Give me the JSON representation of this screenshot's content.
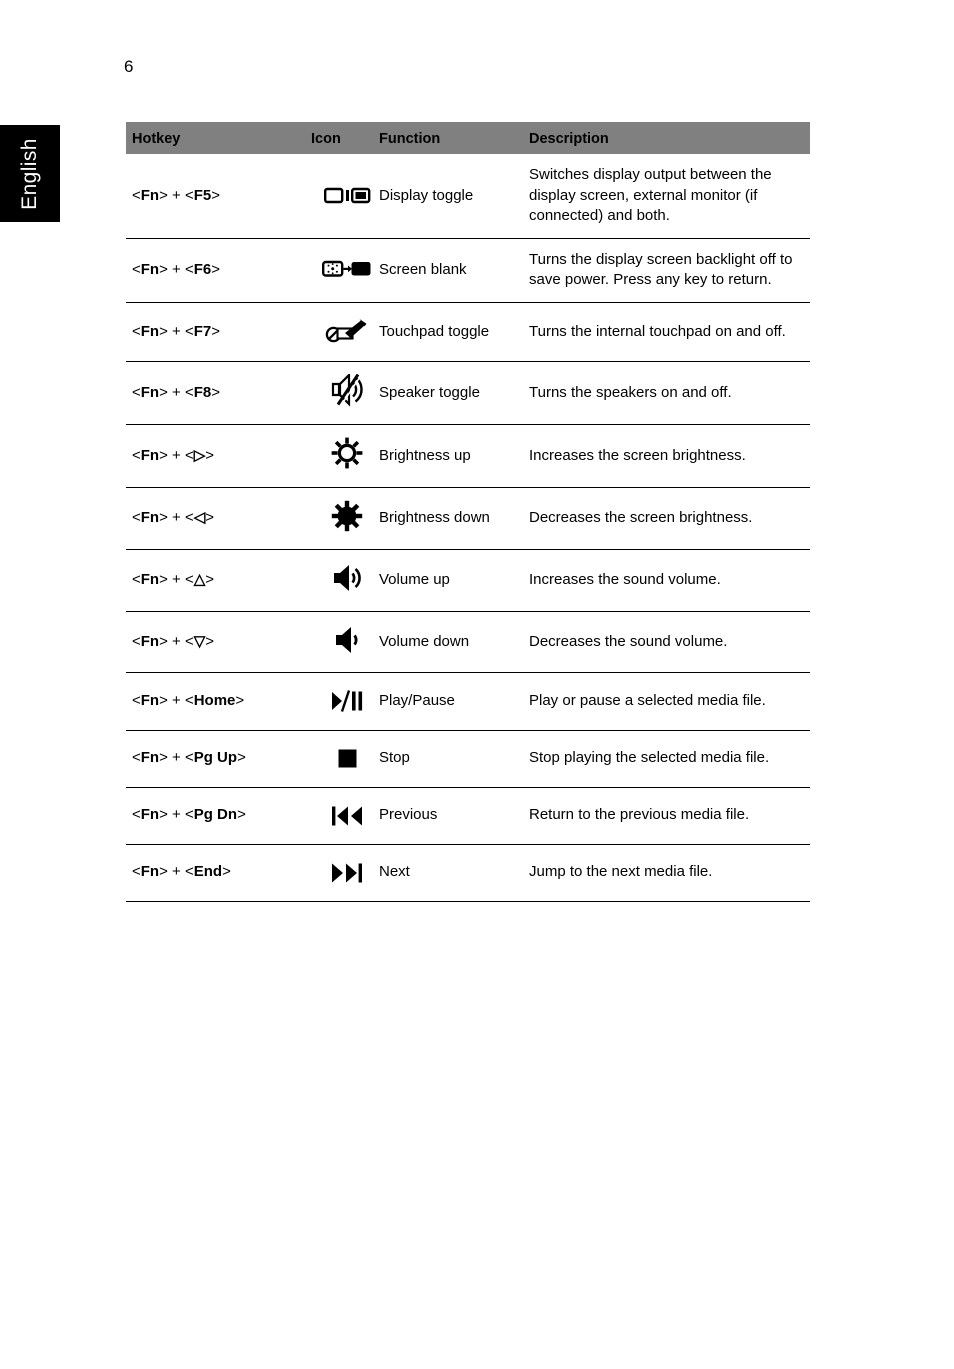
{
  "page": {
    "number": "6",
    "language_tab": "English"
  },
  "table": {
    "headers": {
      "hotkey": "Hotkey",
      "icon": "Icon",
      "function": "Function",
      "description": "Description"
    },
    "rows": [
      {
        "hotkey_prefix": "<",
        "hotkey": "<Fn> + <F5>",
        "hotkey_mod": "Fn",
        "hotkey_key": "F5",
        "icon_name": "display-toggle-icon",
        "function": "Display toggle",
        "description": "Switches display output between the display screen, external monitor (if connected) and both."
      },
      {
        "hotkey": "<Fn> + <F6>",
        "hotkey_mod": "Fn",
        "hotkey_key": "F6",
        "icon_name": "screen-blank-icon",
        "function": "Screen blank",
        "description": "Turns the display screen backlight off to save power. Press any key to return."
      },
      {
        "hotkey": "<Fn> + <F7>",
        "hotkey_mod": "Fn",
        "hotkey_key": "F7",
        "icon_name": "touchpad-toggle-icon",
        "function": "Touchpad toggle",
        "description": "Turns the internal touchpad on and off."
      },
      {
        "hotkey": "<Fn> + <F8>",
        "hotkey_mod": "Fn",
        "hotkey_key": "F8",
        "icon_name": "speaker-toggle-icon",
        "function": "Speaker toggle",
        "description": "Turns the speakers on and off."
      },
      {
        "hotkey": "<Fn> + < ▷ >",
        "hotkey_mod": "Fn",
        "hotkey_key": "▷",
        "icon_name": "brightness-up-icon",
        "function": "Brightness up",
        "description": "Increases the screen brightness."
      },
      {
        "hotkey": "<Fn> + < ◁ >",
        "hotkey_mod": "Fn",
        "hotkey_key": "◁",
        "icon_name": "brightness-down-icon",
        "function": "Brightness down",
        "description": "Decreases the screen brightness."
      },
      {
        "hotkey": "<Fn> + < △ >",
        "hotkey_mod": "Fn",
        "hotkey_key": "△",
        "icon_name": "volume-up-icon",
        "function": "Volume up",
        "description": "Increases the sound volume."
      },
      {
        "hotkey": "<Fn> + < ▽ >",
        "hotkey_mod": "Fn",
        "hotkey_key": "▽",
        "icon_name": "volume-down-icon",
        "function": "Volume down",
        "description": "Decreases the sound volume."
      },
      {
        "hotkey": "<Fn> + <Home>",
        "hotkey_mod": "Fn",
        "hotkey_key": "Home",
        "icon_name": "play-pause-icon",
        "function": "Play/Pause",
        "description": "Play or pause a selected media file."
      },
      {
        "hotkey": "<Fn> + <Pg Up>",
        "hotkey_mod": "Fn",
        "hotkey_key": "Pg Up",
        "icon_name": "stop-icon",
        "function": "Stop",
        "description": "Stop playing the selected media file."
      },
      {
        "hotkey": "<Fn> + <Pg Dn>",
        "hotkey_mod": "Fn",
        "hotkey_key": "Pg Dn",
        "icon_name": "previous-icon",
        "function": "Previous",
        "description": "Return to the previous media file."
      },
      {
        "hotkey": "<Fn> + <End>",
        "hotkey_mod": "Fn",
        "hotkey_key": "End",
        "icon_name": "next-icon",
        "function": "Next",
        "description": "Jump to the next media file."
      }
    ]
  },
  "colors": {
    "header_background": "#808080",
    "tab_background": "#000000",
    "tab_text": "#ffffff",
    "text": "#000000"
  }
}
